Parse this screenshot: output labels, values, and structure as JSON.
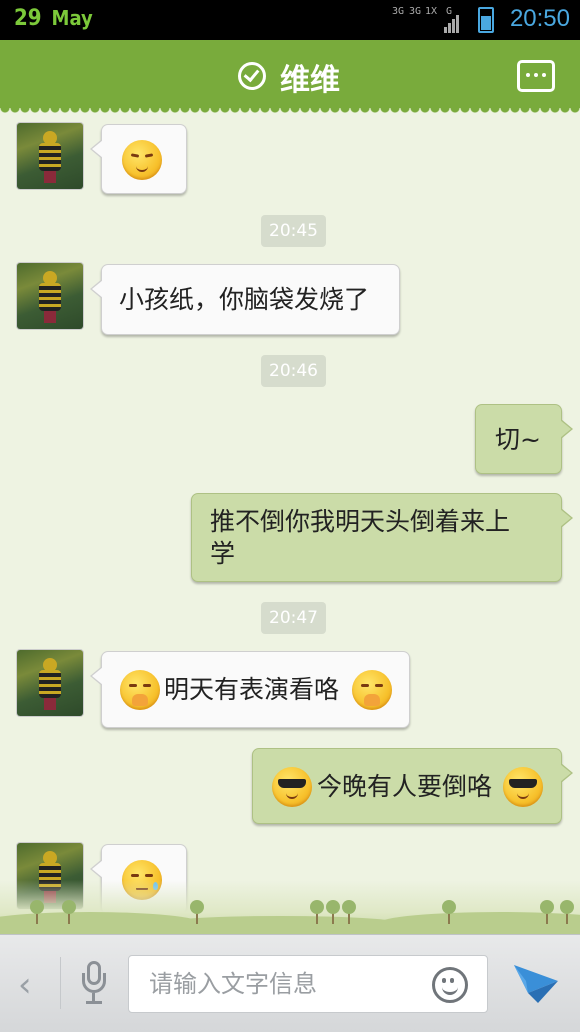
{
  "status_bar": {
    "day": "29",
    "month": "May",
    "network_labels": [
      "3G",
      "3G",
      "1X",
      "G"
    ],
    "time": "20:50"
  },
  "header": {
    "title": "维维",
    "status_icon": "check-circle-icon",
    "menu_icon": "more-dots-icon"
  },
  "messages": [
    {
      "side": "left",
      "type": "emoji",
      "emoji": "content-face"
    },
    {
      "type": "timestamp",
      "text": "20:45"
    },
    {
      "side": "left",
      "type": "text",
      "text": "小孩纸，你脑袋发烧了"
    },
    {
      "type": "timestamp",
      "text": "20:46"
    },
    {
      "side": "right",
      "type": "text",
      "text": "切~"
    },
    {
      "side": "right",
      "type": "text",
      "text_line1": "推不倒你我明天头倒着来上",
      "text_line2": "学"
    },
    {
      "type": "timestamp",
      "text": "20:47"
    },
    {
      "side": "left",
      "type": "text",
      "text": "明天有表演看咯",
      "emoji": "hands-over-mouth-face"
    },
    {
      "side": "right",
      "type": "text",
      "text": "今晚有人要倒咯",
      "emoji": "sunglasses-face"
    },
    {
      "side": "left",
      "type": "emoji",
      "emoji": "sweat-face"
    }
  ],
  "input": {
    "placeholder": "请输入文字信息",
    "back_icon": "chevron-left-icon",
    "voice_icon": "microphone-icon",
    "emoji_icon": "smiley-icon",
    "send_icon": "send-arrow-icon"
  },
  "colors": {
    "header_green": "#79ab3c",
    "chat_background": "#eef3e2",
    "right_bubble": "#cbdca8",
    "left_bubble": "#fafafa",
    "time_accent": "#4aa8e0"
  }
}
